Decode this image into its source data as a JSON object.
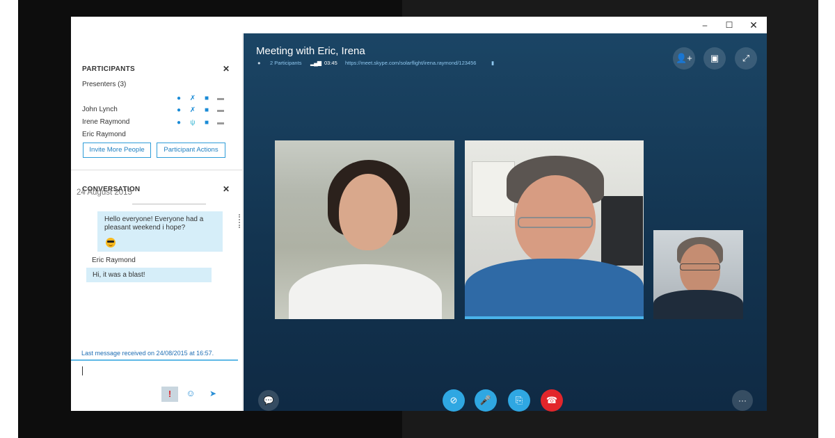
{
  "window": {
    "controls": {
      "minimize": "–",
      "maximize": "☐",
      "close": "✕"
    }
  },
  "participants": {
    "title": "PARTICIPANTS",
    "close": "✕",
    "presenters_label": "Presenters (3)",
    "people": [
      {
        "name": "John Lynch",
        "icons": [
          "chat-icon",
          "mic-muted-icon",
          "video-icon",
          "screen-icon"
        ]
      },
      {
        "name": "Irene Raymond",
        "icons": [
          "chat-icon",
          "mic-active-icon",
          "pause-icon",
          "screen-icon"
        ]
      },
      {
        "name": "Eric Raymond",
        "icons": [
          "chat-icon",
          "mic-active-icon",
          "video-icon",
          "screen-icon"
        ]
      }
    ],
    "invite_button": "Invite More People",
    "actions_button": "Participant Actions"
  },
  "conversation": {
    "title": "CONVERSATION",
    "close": "✕",
    "date": "24 August 2015",
    "messages": [
      {
        "sender": "",
        "text": "Hello everyone! Everyone had a pleasant weekend i hope?",
        "emoji": "sunglasses-emoji"
      },
      {
        "sender": "Eric Raymond",
        "text": "Hi, it was a blast!"
      }
    ],
    "last_message": "Last message received on 24/08/2015 at 16:57.",
    "compose": {
      "alert": "!",
      "emoji": "☺",
      "send": "➤"
    }
  },
  "meeting": {
    "title": "Meeting with Eric, Irena",
    "participants": "2 Participants",
    "duration": "03:45",
    "link": "https://meet.skype.com/solarflight/irena.raymond/123456",
    "signal": "▂▄▆",
    "top_buttons": {
      "add_person": "👤+",
      "layout": "▣",
      "fullscreen": "⤢"
    },
    "call_buttons": {
      "chat": "💬",
      "video": "⊘",
      "mic": "🎤",
      "share": "⎘",
      "end": "☎",
      "more": "···"
    }
  },
  "colors": {
    "accent": "#2fa7e2",
    "end_call": "#e2262b",
    "stage_bg": "#143752",
    "bubble": "#d6eef9",
    "speaker_indicator": "#4ab3ea"
  }
}
